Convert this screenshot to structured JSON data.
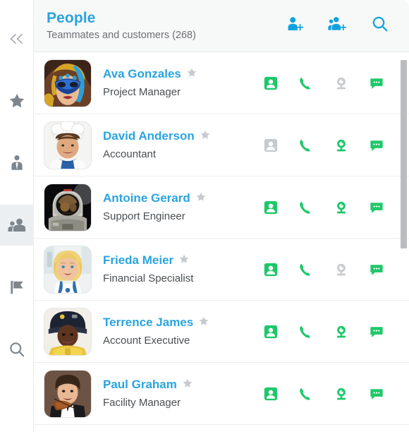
{
  "colors": {
    "accent_blue": "#29a4e0",
    "action_green": "#1ec86a",
    "action_disabled": "#c8cbcd",
    "rail_icon": "#7d858d",
    "star_gray": "#c7cbd0",
    "header_bg": "#f7f8f8",
    "active_rail_bg": "#eceff1"
  },
  "sidebar": {
    "items": [
      {
        "name": "collapse-panel",
        "icon": "chevrons-left-icon",
        "active": false
      },
      {
        "name": "favorites",
        "icon": "star-icon",
        "active": false
      },
      {
        "name": "contacts",
        "icon": "person-tie-icon",
        "active": false
      },
      {
        "name": "people",
        "icon": "people-icon",
        "active": true
      },
      {
        "name": "flagged",
        "icon": "flag-icon",
        "active": false
      },
      {
        "name": "search",
        "icon": "search-icon",
        "active": false
      }
    ]
  },
  "header": {
    "title": "People",
    "subtitle": "Teammates and customers (268)",
    "actions": [
      {
        "name": "add-person-button",
        "icon": "person-add-icon",
        "label": "Add person"
      },
      {
        "name": "add-group-button",
        "icon": "group-add-icon",
        "label": "Add group"
      },
      {
        "name": "search-button",
        "icon": "search-icon",
        "label": "Search"
      }
    ]
  },
  "action_labels": {
    "profile": "Open profile",
    "call": "Call",
    "video": "Video call",
    "chat": "Chat"
  },
  "people": [
    {
      "name": "Ava Gonzales",
      "role": "Project Manager",
      "favorite": false,
      "avatar": "masquerade-mask-woman",
      "actions": {
        "profile": true,
        "call": true,
        "video": false,
        "chat": true
      }
    },
    {
      "name": "David Anderson",
      "role": "Accountant",
      "favorite": false,
      "avatar": "chef-man",
      "actions": {
        "profile": false,
        "call": true,
        "video": true,
        "chat": true
      }
    },
    {
      "name": "Antoine Gerard",
      "role": "Support Engineer",
      "favorite": false,
      "avatar": "astronaut",
      "actions": {
        "profile": true,
        "call": true,
        "video": true,
        "chat": true
      }
    },
    {
      "name": "Frieda Meier",
      "role": "Financial Specialist",
      "favorite": false,
      "avatar": "doctor-woman",
      "actions": {
        "profile": true,
        "call": true,
        "video": false,
        "chat": true
      }
    },
    {
      "name": "Terrence James",
      "role": "Account Executive",
      "favorite": false,
      "avatar": "firefighter",
      "actions": {
        "profile": true,
        "call": true,
        "video": true,
        "chat": true
      }
    },
    {
      "name": "Paul Graham",
      "role": "Facility Manager",
      "favorite": false,
      "avatar": "violinist",
      "actions": {
        "profile": true,
        "call": true,
        "video": true,
        "chat": true
      }
    }
  ],
  "scrollbar": {
    "name": "list-scrollbar",
    "position_percent": 0
  }
}
